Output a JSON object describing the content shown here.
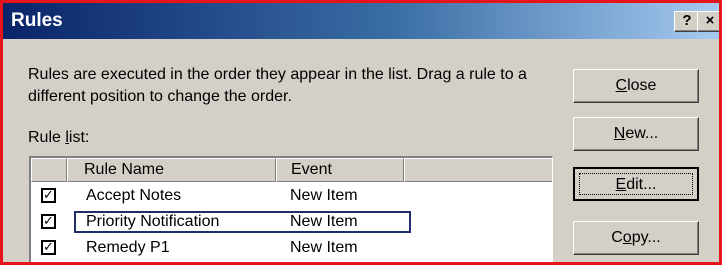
{
  "window": {
    "title": "Rules",
    "help_glyph": "?",
    "close_glyph": "×"
  },
  "description": "Rules are executed in the order they appear in the list.  Drag a rule to a different position to change the order.",
  "rule_list_label": {
    "prefix": "Rule ",
    "accel": "l",
    "suffix": "ist:"
  },
  "columns": [
    "Rule Name",
    "Event"
  ],
  "rules": [
    {
      "checked": true,
      "name": "Accept Notes",
      "event": "New Item"
    },
    {
      "checked": true,
      "name": "Priority Notification",
      "event": "New Item",
      "focused": true
    },
    {
      "checked": true,
      "name": "Remedy P1",
      "event": "New Item"
    }
  ],
  "buttons": {
    "close": {
      "accel": "C",
      "rest": "lose"
    },
    "new": {
      "accel": "N",
      "rest": "ew..."
    },
    "edit": {
      "accel": "E",
      "rest": "dit..."
    },
    "copy": {
      "pre": "C",
      "accel": "o",
      "rest": "py..."
    }
  },
  "colors": {
    "frame_border": "#e8141c",
    "titlebar_start": "#0a246a",
    "titlebar_end": "#a6caf0",
    "dialog_face": "#d4d0c8",
    "focus_border": "#1f2d6b"
  }
}
